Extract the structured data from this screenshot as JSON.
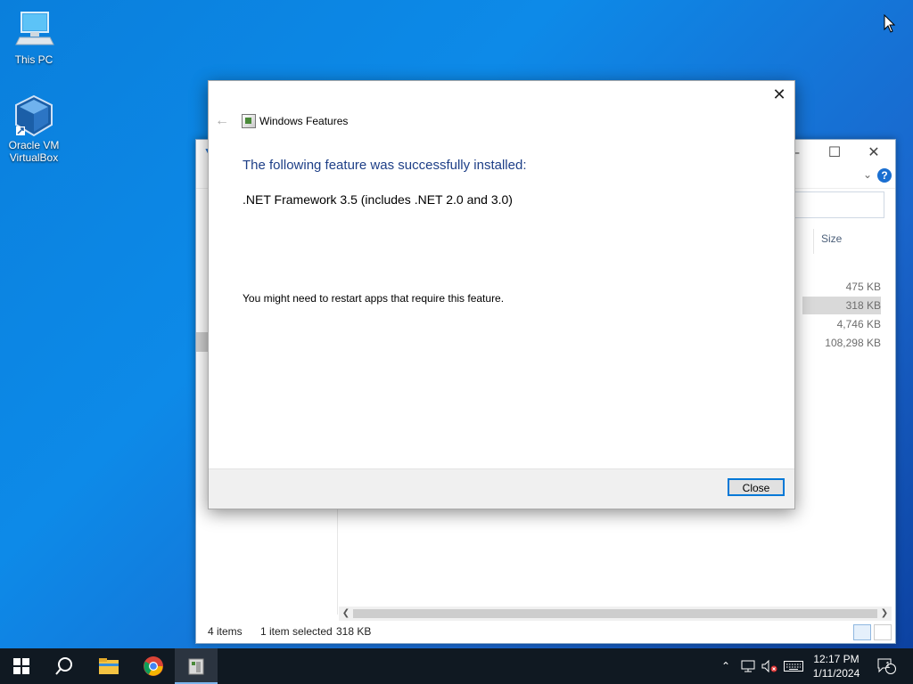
{
  "desktop": {
    "icons": [
      {
        "label": "This PC",
        "icon": "computer-icon"
      },
      {
        "label": "Oracle VM VirtualBox",
        "label_line1": "Oracle VM",
        "label_line2": "VirtualBox",
        "icon": "virtualbox-icon"
      }
    ]
  },
  "explorer": {
    "column_size": "Size",
    "sizes": [
      "475 KB",
      "318 KB",
      "4,746 KB",
      "108,298 KB"
    ],
    "selected_index": 1,
    "status": {
      "items": "4 items",
      "selected": "1 item selected",
      "selected_size": "318 KB"
    },
    "controls": {
      "minimize": "–",
      "maximize": "☐",
      "close": "✕"
    }
  },
  "dialog": {
    "app_title": "Windows Features",
    "heading": "The following feature was successfully installed:",
    "feature": ".NET Framework 3.5 (includes .NET 2.0 and 3.0)",
    "note": "You might need to restart apps that require this feature.",
    "close_button": "Close"
  },
  "taskbar": {
    "clock_time": "12:17 PM",
    "clock_date": "1/11/2024",
    "notification_count": "1",
    "pinned": [
      "windows-start-icon",
      "search-icon",
      "file-explorer-icon",
      "chrome-icon",
      "windows-features-icon"
    ]
  },
  "colors": {
    "accent": "#0078d7",
    "heading": "#1e3f87",
    "taskbar": "#101922"
  }
}
